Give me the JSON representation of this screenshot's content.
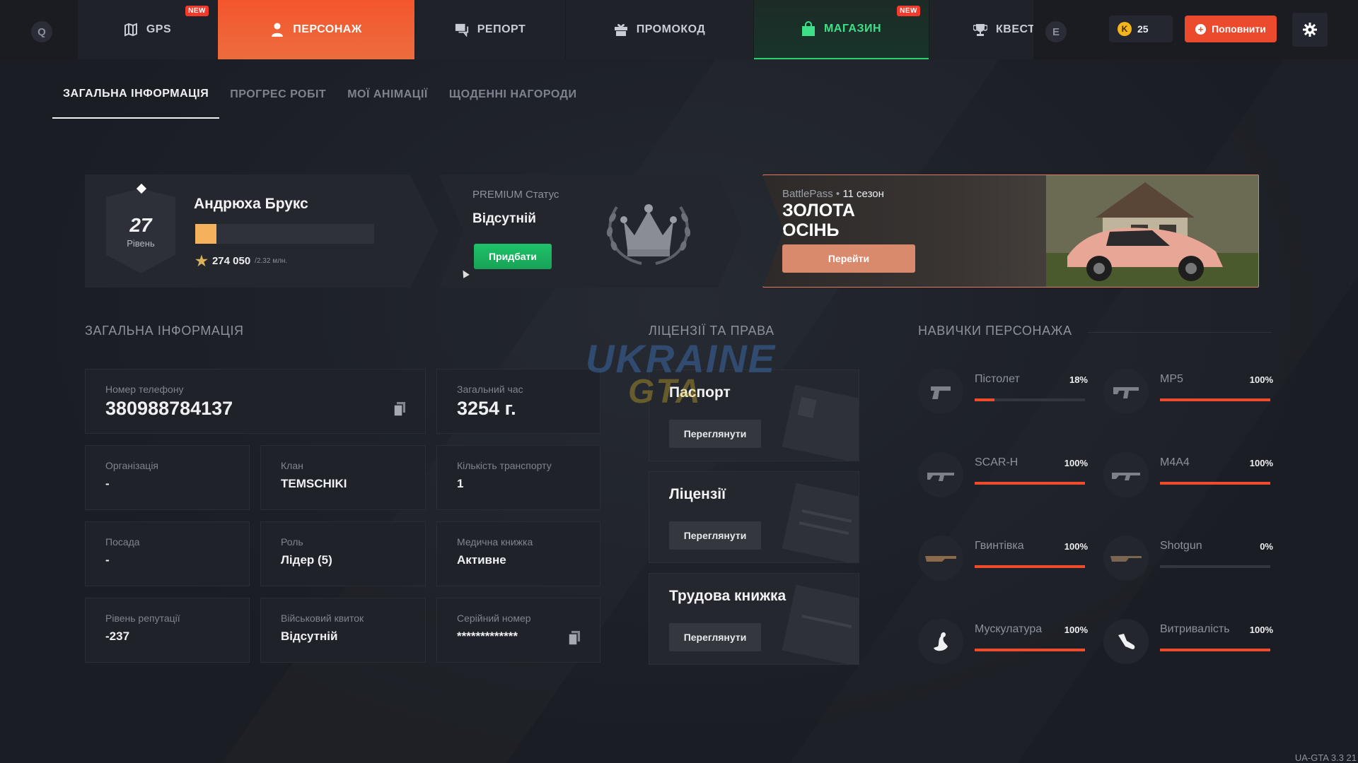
{
  "hotkeys": {
    "left": "Q",
    "right": "E"
  },
  "nav": {
    "tabs": [
      {
        "label": "GPS",
        "icon": "map-icon",
        "badge": "NEW"
      },
      {
        "label": "ПЕРСОНАЖ",
        "icon": "person-icon",
        "active": true
      },
      {
        "label": "РЕПОРТ",
        "icon": "chat-icon"
      },
      {
        "label": "ПРОМОКОД",
        "icon": "gift-icon"
      },
      {
        "label": "МАГАЗИН",
        "icon": "shopping-bag-icon",
        "badge": "NEW"
      },
      {
        "label": "КВЕСТ",
        "icon": "trophy-icon"
      }
    ],
    "coins": "25",
    "coin_symbol": "K",
    "topup_label": "Поповнити"
  },
  "subtabs": [
    "ЗАГАЛЬНА ІНФОРМАЦІЯ",
    "ПРОГРЕС РОБІТ",
    "МОЇ АНІМАЦІЇ",
    "ЩОДЕННІ НАГОРОДИ"
  ],
  "profile": {
    "level": "27",
    "level_label": "Рівень",
    "name": "Андрюха Брукс",
    "xp_value": "274 050",
    "xp_max": "/2.32 млн.",
    "xp_progress": 0.118
  },
  "premium": {
    "label": "PREMIUM Статус",
    "value": "Відсутній",
    "buy_label": "Придбати"
  },
  "battlepass": {
    "label": "BattlePass",
    "season": "11 сезон",
    "title_line1": "ЗОЛОТА",
    "title_line2": "ОСІНЬ",
    "button": "Перейти"
  },
  "sections": {
    "general": "ЗАГАЛЬНА ІНФОРМАЦІЯ",
    "licenses": "ЛІЦЕНЗІЇ ТА ПРАВА",
    "skills": "НАВИЧКИ ПЕРСОНАЖА"
  },
  "info": {
    "phone": {
      "label": "Номер телефону",
      "value": "380988784137"
    },
    "total_time": {
      "label": "Загальний час",
      "value": "3254 г."
    },
    "org": {
      "label": "Організація",
      "value": "-"
    },
    "clan": {
      "label": "Клан",
      "value": "TEMSCHIKI"
    },
    "vehicles": {
      "label": "Кількість транспорту",
      "value": "1"
    },
    "position": {
      "label": "Посада",
      "value": "-"
    },
    "role": {
      "label": "Роль",
      "value": "Лідер (5)"
    },
    "medical": {
      "label": "Медична книжка",
      "value": "Активне"
    },
    "reputation": {
      "label": "Рівень репутації",
      "value": "-237"
    },
    "military": {
      "label": "Військовий квиток",
      "value": "Відсутній"
    },
    "serial": {
      "label": "Серійний номер",
      "value": "*************"
    }
  },
  "licenses": [
    {
      "title": "Паспорт",
      "button": "Переглянути"
    },
    {
      "title": "Ліцензії",
      "button": "Переглянути"
    },
    {
      "title": "Трудова книжка",
      "button": "Переглянути"
    }
  ],
  "skills": [
    {
      "name": "Пістолет",
      "pct": "18%",
      "value": 18,
      "icon": "pistol-icon"
    },
    {
      "name": "MP5",
      "pct": "100%",
      "value": 100,
      "icon": "smg-icon"
    },
    {
      "name": "SCAR-H",
      "pct": "100%",
      "value": 100,
      "icon": "rifle-icon"
    },
    {
      "name": "M4A4",
      "pct": "100%",
      "value": 100,
      "icon": "assault-rifle-icon"
    },
    {
      "name": "Гвинтівка",
      "pct": "100%",
      "value": 100,
      "icon": "sniper-rifle-icon"
    },
    {
      "name": "Shotgun",
      "pct": "0%",
      "value": 0,
      "icon": "shotgun-icon"
    },
    {
      "name": "Мускулатура",
      "pct": "100%",
      "value": 100,
      "icon": "muscle-icon"
    },
    {
      "name": "Витривалість",
      "pct": "100%",
      "value": 100,
      "icon": "running-shoe-icon"
    }
  ],
  "watermark": {
    "line1": "UKRAINE",
    "line2": "GTA"
  },
  "version": "UA-GTA 3.3  21",
  "colors": {
    "accent": "#ec4a2c",
    "shop_green": "#2ecf6d",
    "buy_green": "#1ec26a",
    "xp_fill": "#f4b25d",
    "coin": "#f5b41a"
  }
}
